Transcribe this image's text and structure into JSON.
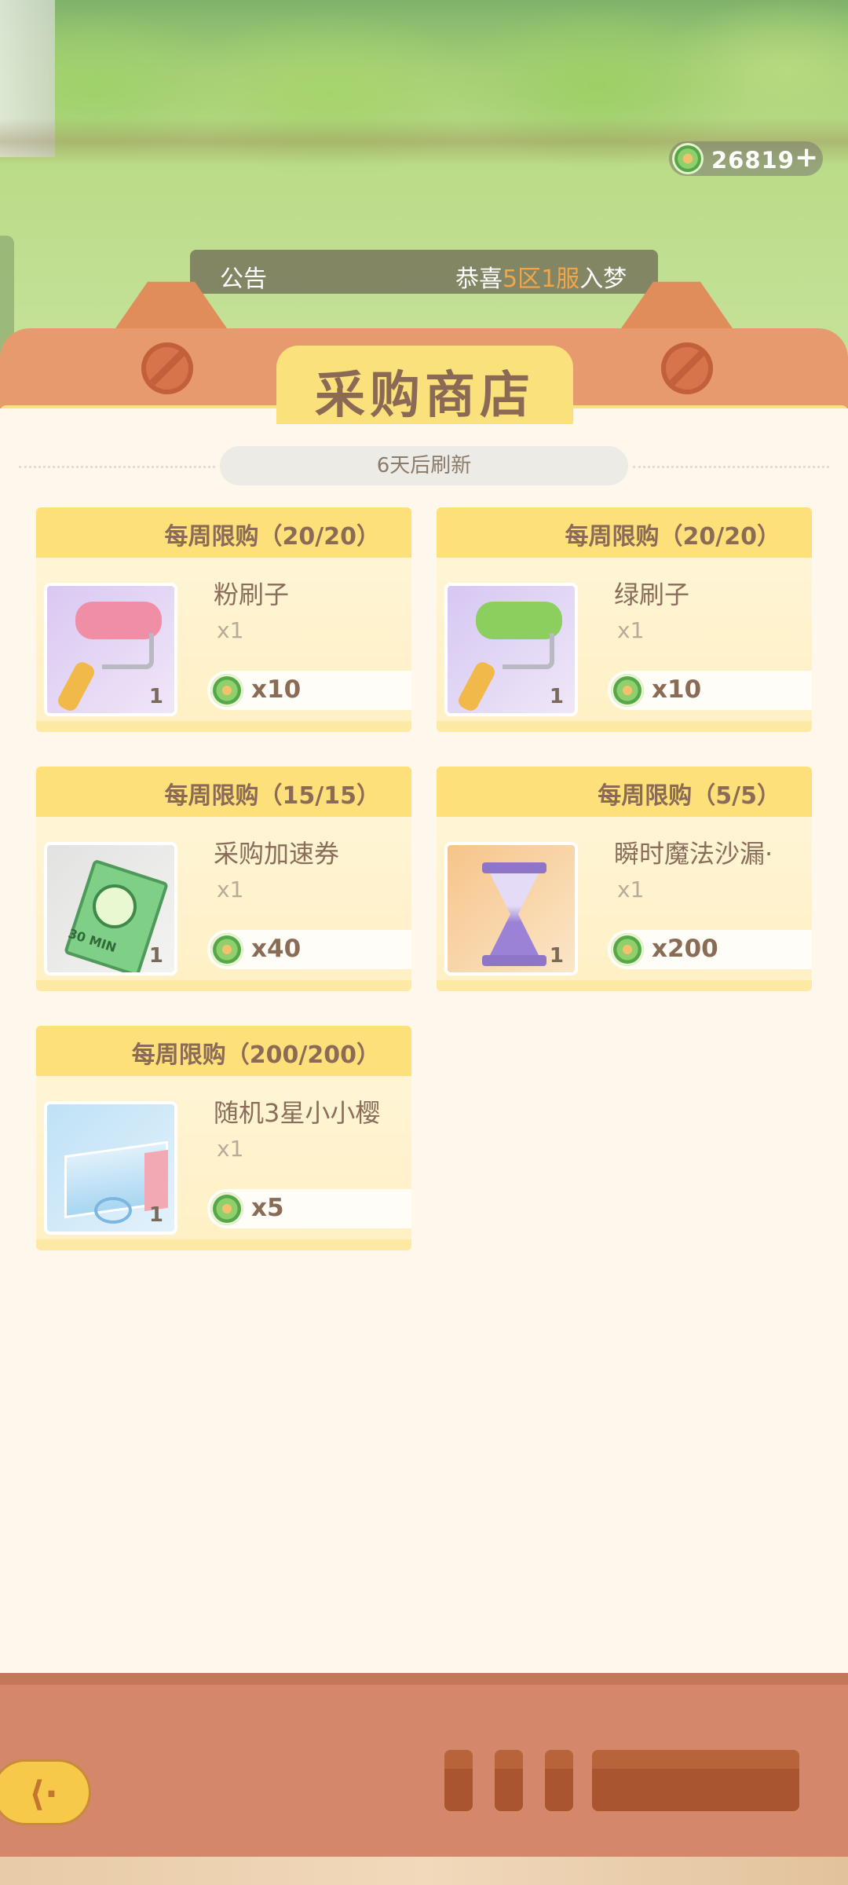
{
  "currency": {
    "icon": "rainbow-coin-icon",
    "amount": "26819",
    "plus_icon": "plus-icon"
  },
  "notice": {
    "label": "公告",
    "text_parts": [
      "恭喜",
      "5区1服",
      "入梦"
    ]
  },
  "shop": {
    "title": "采购商店",
    "refresh": "6天后刷新"
  },
  "items": [
    {
      "limit": "每周限购（20/20）",
      "name": "粉刷子",
      "mult": "x1",
      "qty": "1",
      "price": "x10",
      "icon": "pink-paint-roller-icon"
    },
    {
      "limit": "每周限购（20/20）",
      "name": "绿刷子",
      "mult": "x1",
      "qty": "1",
      "price": "x10",
      "icon": "green-paint-roller-icon"
    },
    {
      "limit": "每周限购（15/15）",
      "name": "采购加速券",
      "mult": "x1",
      "qty": "1",
      "price": "x40",
      "icon": "speed-ticket-icon"
    },
    {
      "limit": "每周限购（5/5）",
      "name": "瞬时魔法沙漏·",
      "mult": "x1",
      "qty": "1",
      "price": "x200",
      "icon": "magic-hourglass-icon"
    },
    {
      "limit": "每周限购（200/200）",
      "name": "随机3星小小樱",
      "mult": "x1",
      "qty": "1",
      "price": "x5",
      "icon": "gift-box-icon"
    }
  ],
  "ticket_text": "30 MIN",
  "colors": {
    "frame": "#e79a6e",
    "panel": "#fdf7ec",
    "header_yellow": "#fde07a",
    "highlight": "#f2a64a"
  }
}
